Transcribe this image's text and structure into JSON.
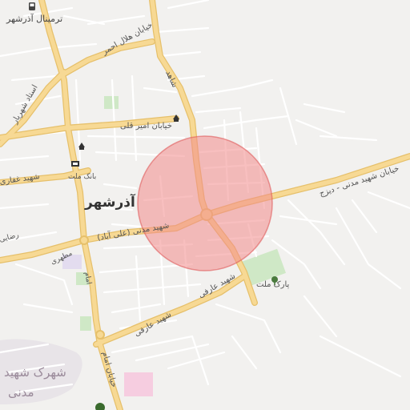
{
  "map": {
    "city_name": "آذرشهر",
    "district_label_line1": "شهرک شهید",
    "district_label_line2": "مدنی",
    "labels": {
      "terminal": "ترمینال آذرشهر",
      "helal_ahmar": "خیابان هلال احمر",
      "shahed": "شاهد",
      "ostad_shahriar": "استاد شهریار",
      "amir_gholi": "خیابان امیر قلی",
      "ghaffari": "شهید غفاری",
      "bank_mellat": "بانک ملت",
      "madani_dehkhoda": "خیابان شهید مدنی - دیزج",
      "madani_aliabad": "شهید مدنی (علی آباد)",
      "motahari": "مطهری",
      "razi": "رضایی",
      "emam": "امام",
      "park_mellat": "پارک ملت",
      "arefi_1": "شهید عارفی",
      "arefi_2": "شهید عارفی",
      "emam_street": "خیابان امام"
    },
    "colors": {
      "background": "#f2f1ef",
      "main_road": "#f7d994",
      "main_road_outline": "#e6c06b",
      "minor_road": "#ffffff",
      "park": "#cfe8c6",
      "highlight_fill": "#f28b8b",
      "highlight_stroke": "#e05a5a"
    },
    "icons": [
      "bus-icon",
      "building-icon",
      "bank-icon",
      "tree-icon"
    ]
  }
}
